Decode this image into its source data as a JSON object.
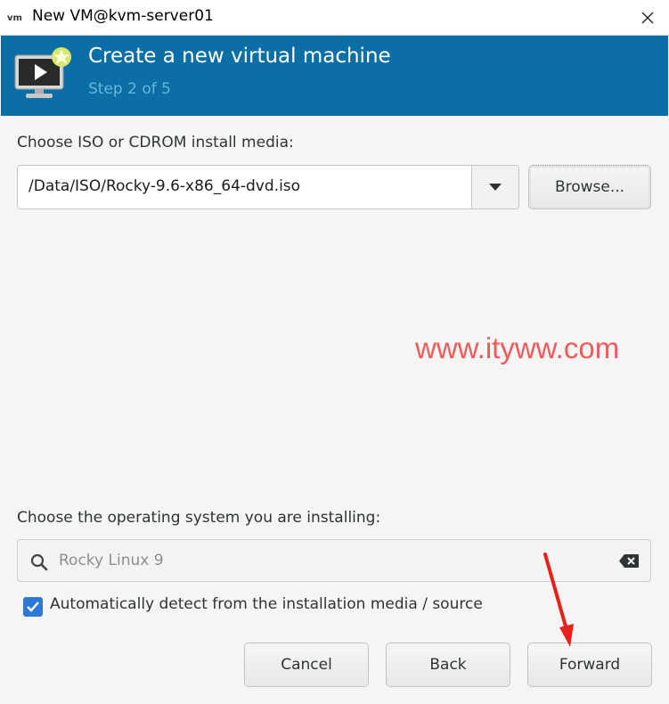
{
  "window": {
    "title": "New VM@kvm-server01",
    "app_icon": "virt-manager-icon",
    "close_icon": "close-icon"
  },
  "header": {
    "title": "Create a new virtual machine",
    "step": "Step 2 of 5",
    "icon": "vm-display-icon",
    "background_color": "#0b6ea5"
  },
  "install_media": {
    "label": "Choose ISO or CDROM install media:",
    "value": "/Data/ISO/Rocky-9.6-x86_64-dvd.iso",
    "browse_label": "Browse..."
  },
  "watermark": "www.ityww.com",
  "os": {
    "label": "Choose the operating system you are installing:",
    "search_value": "Rocky Linux 9",
    "autodetect_label": "Automatically detect from the installation media / source",
    "autodetect_checked": true
  },
  "buttons": {
    "cancel": "Cancel",
    "back": "Back",
    "forward": "Forward"
  },
  "colors": {
    "accent": "#2c7ad6",
    "annotation_arrow": "#e8201a"
  }
}
